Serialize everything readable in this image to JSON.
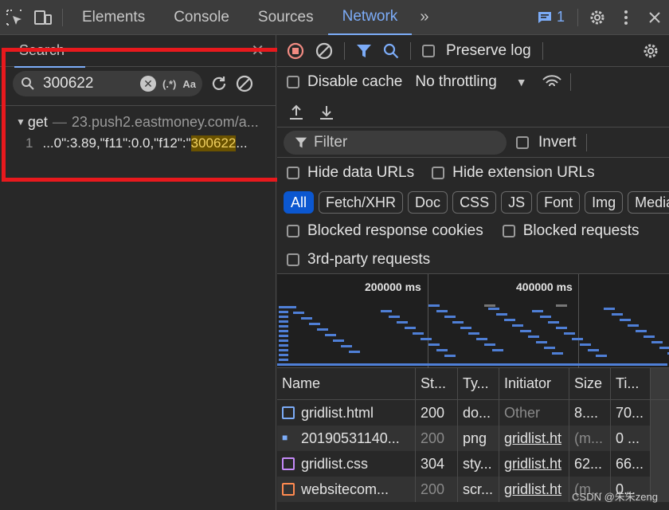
{
  "topbar": {
    "tabs": [
      {
        "label": "Elements"
      },
      {
        "label": "Console"
      },
      {
        "label": "Sources"
      },
      {
        "label": "Network"
      }
    ],
    "message_count": "1"
  },
  "search": {
    "title": "Search",
    "query": "300622",
    "regex_label": "(.*)",
    "case_label": "Aa",
    "result_file": "get",
    "result_url": "23.push2.eastmoney.com/a...",
    "result_line_no": "1",
    "result_prefix": "...0\":3.89,\"f11\":0.0,\"f12\":\"",
    "result_match": "300622",
    "result_suffix": "..."
  },
  "network": {
    "preserve_log": "Preserve log",
    "disable_cache": "Disable cache",
    "throttling": "No throttling",
    "filter_placeholder": "Filter",
    "invert": "Invert",
    "hide_data_urls": "Hide data URLs",
    "hide_extension_urls": "Hide extension URLs",
    "type_filters": [
      "All",
      "Fetch/XHR",
      "Doc",
      "CSS",
      "JS",
      "Font",
      "Img",
      "Media"
    ],
    "blocked_cookies": "Blocked response cookies",
    "blocked_requests": "Blocked requests",
    "third_party": "3rd-party requests",
    "overview_labels": [
      "200000 ms",
      "400000 ms"
    ],
    "columns": [
      "Name",
      "St...",
      "Ty...",
      "Initiator",
      "Size",
      "Ti..."
    ],
    "rows": [
      {
        "name": "gridlist.html",
        "status": "200",
        "type": "do...",
        "initiator": "Other",
        "size": "8....",
        "time": "70..."
      },
      {
        "name": "20190531140...",
        "status": "200",
        "type": "png",
        "initiator": "gridlist.ht",
        "size": "(m...",
        "time": "0 ..."
      },
      {
        "name": "gridlist.css",
        "status": "304",
        "type": "sty...",
        "initiator": "gridlist.ht",
        "size": "62...",
        "time": "66..."
      },
      {
        "name": "websitecom...",
        "status": "200",
        "type": "scr...",
        "initiator": "gridlist.ht",
        "size": "(m...",
        "time": "0..."
      }
    ]
  },
  "watermark": "CSDN @朱朱zeng"
}
